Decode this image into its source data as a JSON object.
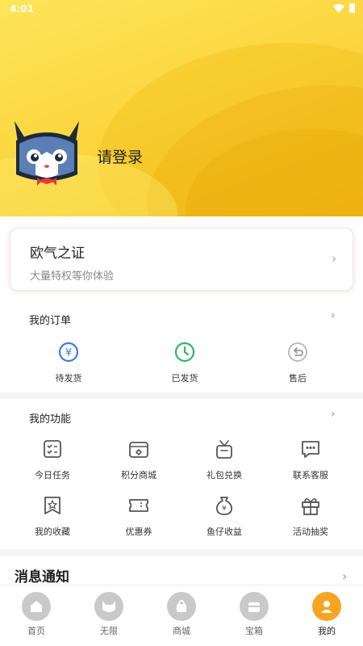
{
  "status": {
    "time": "4:01"
  },
  "profile": {
    "login_text": "请登录"
  },
  "card": {
    "title": "欧气之证",
    "subtitle": "大量特权等你体验"
  },
  "orders": {
    "title": "我的订单",
    "items": [
      {
        "label": "待发货",
        "icon": "yuan-clock-icon"
      },
      {
        "label": "已发货",
        "icon": "clock-icon"
      },
      {
        "label": "售后",
        "icon": "return-icon"
      }
    ]
  },
  "functions": {
    "title": "我的功能",
    "items": [
      {
        "label": "今日任务",
        "icon": "task-list-icon"
      },
      {
        "label": "积分商城",
        "icon": "points-mall-icon"
      },
      {
        "label": "礼包兑换",
        "icon": "gift-bag-icon"
      },
      {
        "label": "联系客服",
        "icon": "chat-icon"
      },
      {
        "label": "我的收藏",
        "icon": "bookmark-star-icon"
      },
      {
        "label": "优惠券",
        "icon": "coupon-icon"
      },
      {
        "label": "鱼仔收益",
        "icon": "money-bag-icon"
      },
      {
        "label": "活动抽奖",
        "icon": "gift-box-icon"
      }
    ]
  },
  "messages": {
    "title": "消息通知"
  },
  "tabs": [
    {
      "label": "首页",
      "icon": "home-icon"
    },
    {
      "label": "无限",
      "icon": "cat-icon"
    },
    {
      "label": "商城",
      "icon": "shopping-bag-icon"
    },
    {
      "label": "宝箱",
      "icon": "treasure-box-icon"
    },
    {
      "label": "我的",
      "icon": "user-icon",
      "active": true
    }
  ],
  "colors": {
    "header_yellow": "#fbd63f",
    "accent_orange": "#f7a521",
    "order_blue": "#3b7de0",
    "order_green": "#2cb866"
  }
}
